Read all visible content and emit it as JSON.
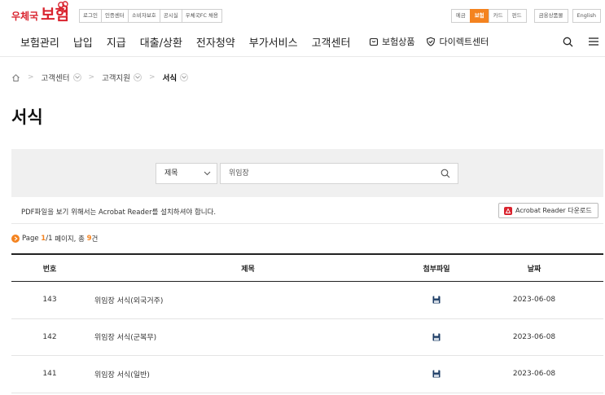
{
  "brand": {
    "small": "우체국",
    "big": "보험"
  },
  "util_links": [
    "로그인",
    "인증센터",
    "소비자보호",
    "공시실",
    "우체국FC 채용"
  ],
  "util_tabs": [
    {
      "label": "예금",
      "active": false
    },
    {
      "label": "보험",
      "active": true
    },
    {
      "label": "카드",
      "active": false
    },
    {
      "label": "펀드",
      "active": false
    }
  ],
  "util_solo": [
    "금융상품몰",
    "English"
  ],
  "gnb": [
    "보험관리",
    "납입",
    "지급",
    "대출/상환",
    "전자청약",
    "부가서비스",
    "고객센터"
  ],
  "gnb_ext": [
    {
      "label": "보험상품",
      "icon": "basket-icon"
    },
    {
      "label": "다이렉트센터",
      "icon": "shield-check-icon"
    }
  ],
  "breadcrumb": {
    "level1": "고객센터",
    "level2": "고객지원",
    "current": "서식"
  },
  "page_title": "서식",
  "search": {
    "field": "제목",
    "value": "위임장"
  },
  "notice": "PDF파일을 보기 위해서는 Acrobat Reader를 설치하셔야 합니다.",
  "acrobat_button": "Acrobat Reader 다운로드",
  "pageinfo": {
    "prefix": "Page",
    "current": "1",
    "slash": "/",
    "total_pages": "1",
    "mid": "페이지, 총",
    "count": "9",
    "suffix": "건"
  },
  "table": {
    "headers": {
      "num": "번호",
      "title": "제목",
      "file": "첨부파일",
      "date": "날짜"
    },
    "rows": [
      {
        "num": "143",
        "title": "위임장 서식(외국거주)",
        "date": "2023-06-08"
      },
      {
        "num": "142",
        "title": "위임장 서식(군복무)",
        "date": "2023-06-08"
      },
      {
        "num": "141",
        "title": "위임장 서식(일반)",
        "date": "2023-06-08"
      }
    ]
  },
  "colors": {
    "brand_red": "#d9232e",
    "accent_orange": "#f4831f",
    "file_icon": "#1d3d66"
  }
}
